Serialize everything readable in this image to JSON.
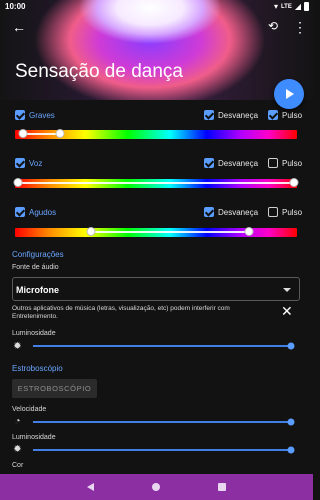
{
  "status": {
    "time": "10:00",
    "network": "LTE"
  },
  "header": {
    "title": "Sensação de dança"
  },
  "bands": [
    {
      "name": "Graves",
      "checked": true,
      "desvaneca_label": "Desvaneça",
      "desvaneca": true,
      "pulso_label": "Pulso",
      "pulso": true,
      "range": [
        0.03,
        0.16
      ]
    },
    {
      "name": "Voz",
      "checked": true,
      "desvaneca_label": "Desvaneça",
      "desvaneca": true,
      "pulso_label": "Pulso",
      "pulso": false,
      "range": [
        0.01,
        0.99
      ]
    },
    {
      "name": "Agudos",
      "checked": true,
      "desvaneca_label": "Desvaneça",
      "desvaneca": true,
      "pulso_label": "Pulso",
      "pulso": false,
      "range": [
        0.27,
        0.83
      ]
    }
  ],
  "config": {
    "section_title": "Configurações",
    "audio_source_label": "Fonte de áudio",
    "audio_source_value": "Microfone",
    "note": "Outros aplicativos de música (letras, visualização, etc) podem interferir com Entretenimento.",
    "brightness_label": "Luminosidade",
    "brightness": 1.0
  },
  "strobe": {
    "section_title": "Estroboscópio",
    "button_label": "ESTROBOSCÓPIO",
    "speed_label": "Velocidade",
    "speed": 1.0,
    "brightness_label": "Luminosidade",
    "brightness": 1.0,
    "color_label": "Cor"
  },
  "colors": {
    "accent": "#5b9dff",
    "navbar": "#8c2fa3"
  }
}
